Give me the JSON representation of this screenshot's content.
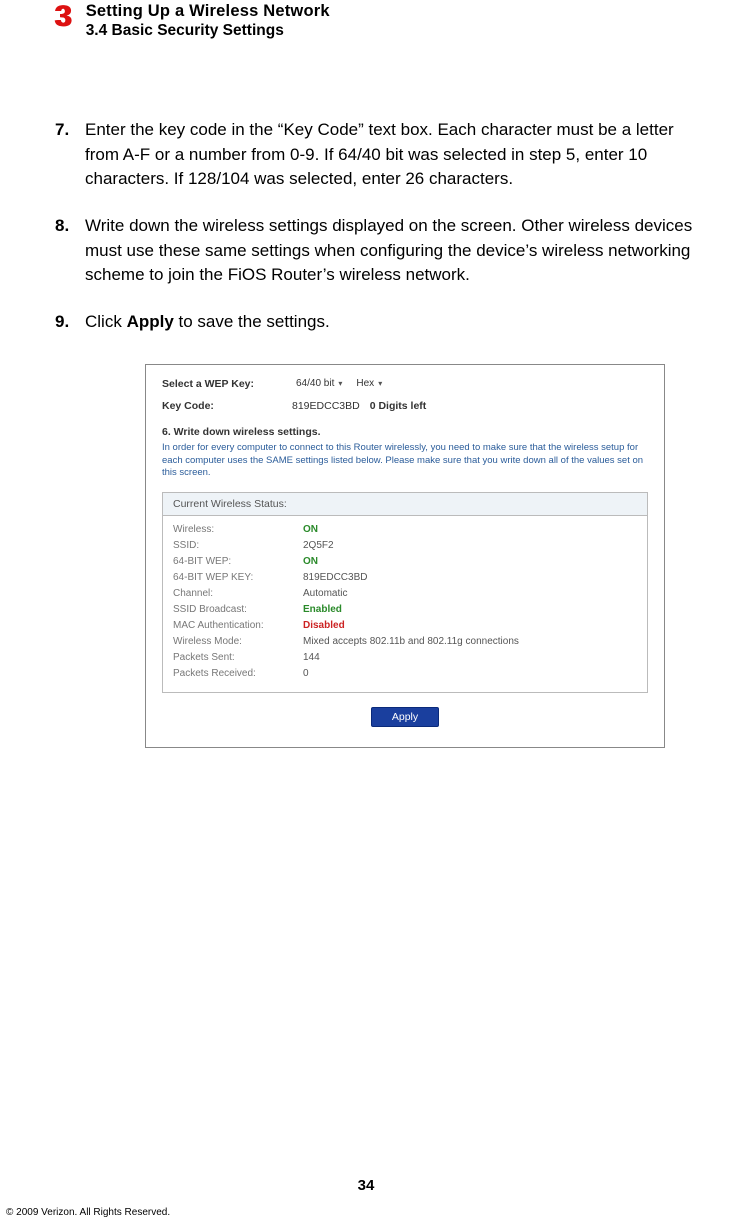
{
  "header": {
    "chapter_number": "3",
    "chapter_title": "Setting Up a Wireless Network",
    "section_title": "3.4  Basic Security Settings"
  },
  "steps": [
    {
      "num": "7.",
      "text": "Enter the key code in the “Key Code” text box. Each character must be a letter from A-F or a number from 0-9. If 64/40 bit was selected in step 5, enter 10 characters. If 128/104 was selected, enter 26 characters."
    },
    {
      "num": "8.",
      "text": "Write down the wireless settings displayed on the screen. Other wireless devices must use these same settings when configuring the device’s wireless networking scheme to join the FiOS Router’s wireless network."
    },
    {
      "num": "9.",
      "text_before": "Click ",
      "bold": "Apply",
      "text_after": " to save the settings."
    }
  ],
  "screenshot": {
    "select_label": "Select a WEP Key:",
    "select_value": "64/40 bit",
    "select_format": "Hex",
    "keycode_label": "Key Code:",
    "keycode_value": "819EDCC3BD",
    "digits_left": "0 Digits left",
    "section6_head": "6. Write down wireless settings.",
    "section6_note": "In order for every computer to connect to this Router wirelessly, you need to make sure that the wireless setup for each computer uses the SAME settings listed below. Please make sure that you write down all of the values set on this screen.",
    "status_head": "Current Wireless Status:",
    "rows": [
      {
        "k": "Wireless:",
        "v": "ON",
        "cls": "v-green"
      },
      {
        "k": "SSID:",
        "v": "2Q5F2",
        "cls": ""
      },
      {
        "k": "64-BIT WEP:",
        "v": "ON",
        "cls": "v-green"
      },
      {
        "k": "64-BIT WEP KEY:",
        "v": "819EDCC3BD",
        "cls": ""
      },
      {
        "k": "Channel:",
        "v": "Automatic",
        "cls": ""
      },
      {
        "k": "SSID Broadcast:",
        "v": "Enabled",
        "cls": "v-green"
      },
      {
        "k": "MAC Authentication:",
        "v": "Disabled",
        "cls": "v-red"
      },
      {
        "k": "Wireless Mode:",
        "v": "Mixed accepts 802.11b and 802.11g connections",
        "cls": ""
      },
      {
        "k": "Packets Sent:",
        "v": "144",
        "cls": ""
      },
      {
        "k": "Packets Received:",
        "v": "0",
        "cls": ""
      }
    ],
    "apply_label": "Apply"
  },
  "footer": {
    "page_number": "34",
    "copyright": "© 2009 Verizon. All Rights Reserved."
  }
}
